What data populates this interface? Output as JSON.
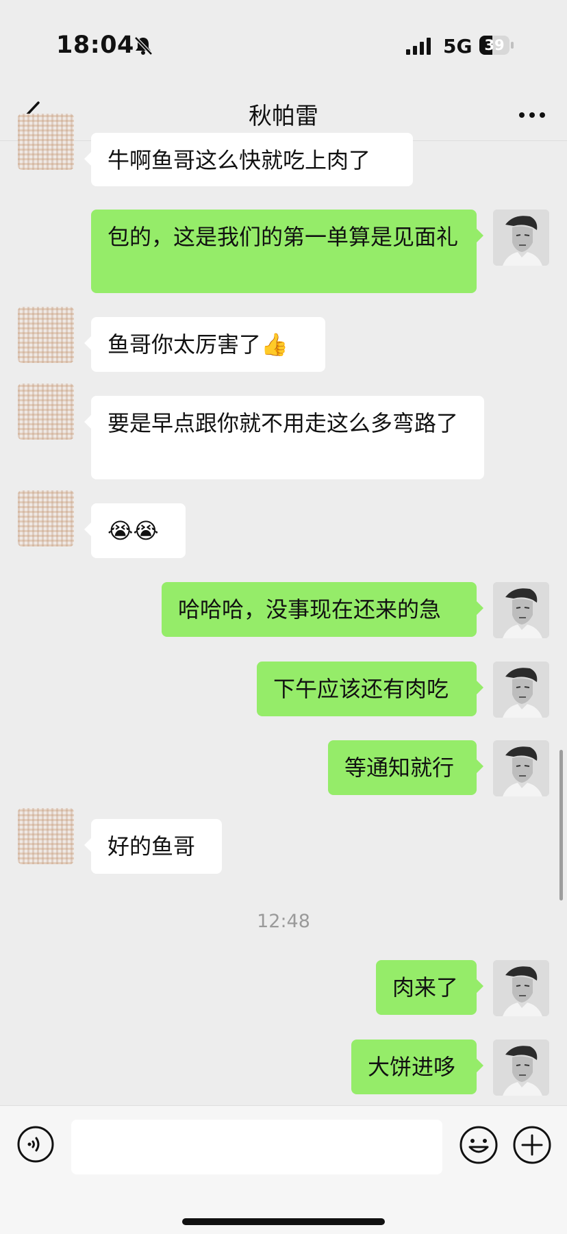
{
  "status_bar": {
    "time": "18:04",
    "network": "5G",
    "battery": "39",
    "icons": [
      "bell-slash-icon",
      "signal-icon",
      "battery-icon"
    ]
  },
  "header": {
    "title": "秋帕雷",
    "back_icon": "chevron-left-icon",
    "more_icon": "more-dots-icon"
  },
  "messages": [
    {
      "from": "other",
      "text": "牛啊鱼哥这么快就吃上肉了"
    },
    {
      "from": "me",
      "text": "包的，这是我们的第一单算是见面礼"
    },
    {
      "from": "other",
      "text": "鱼哥你太厉害了👍"
    },
    {
      "from": "other",
      "text": "要是早点跟你就不用走这么多弯路了"
    },
    {
      "from": "other",
      "text": "😭😭"
    },
    {
      "from": "me",
      "text": "哈哈哈，没事现在还来的急"
    },
    {
      "from": "me",
      "text": "下午应该还有肉吃"
    },
    {
      "from": "me",
      "text": "等通知就行"
    },
    {
      "from": "other",
      "text": "好的鱼哥"
    },
    {
      "from": "me",
      "text": "肉来了"
    },
    {
      "from": "me",
      "text": "大饼进哆"
    }
  ],
  "timestamp": "12:48",
  "input_bar": {
    "placeholder": "",
    "icons": [
      "voice-icon",
      "emoji-icon",
      "plus-icon"
    ]
  },
  "colors": {
    "background": "#ededed",
    "my_bubble": "#95ec69",
    "their_bubble": "#ffffff"
  }
}
